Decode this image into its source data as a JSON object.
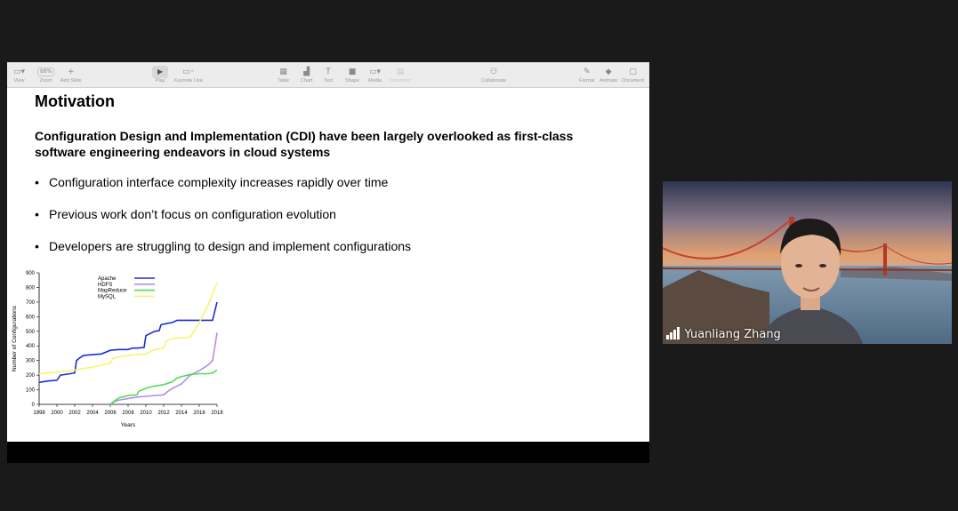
{
  "toolbar": {
    "view": "View",
    "zoom_value": "88%",
    "zoom": "Zoom",
    "add_slide": "Add Slide",
    "play": "Play",
    "keynote_live": "Keynote Live",
    "table": "Table",
    "chart": "Chart",
    "text": "Text",
    "shape": "Shape",
    "media": "Media",
    "comment": "Comment",
    "collaborate": "Collaborate",
    "format": "Format",
    "animate": "Animate",
    "document": "Document"
  },
  "slide": {
    "title": "Motivation",
    "lead": "Configuration Design and Implementation (CDI) have been largely overlooked as first-class software engineering endeavors in cloud systems",
    "bullets": [
      "Configuration interface complexity increases rapidly over time",
      "Previous work don’t focus on configuration evolution",
      "Developers are struggling to design and implement configurations"
    ]
  },
  "participant": {
    "name": "Yuanliang Zhang"
  },
  "chart_data": {
    "type": "line",
    "xlabel": "Years",
    "ylabel": "Number of Configurations",
    "xlim": [
      1998,
      2018
    ],
    "ylim": [
      0,
      900
    ],
    "xticks": [
      "1998",
      "2000",
      "2002",
      "2004",
      "2006",
      "2008",
      "2010",
      "2012",
      "2014",
      "2016",
      "2018"
    ],
    "yticks": [
      "0",
      "100",
      "200",
      "300",
      "400",
      "500",
      "600",
      "700",
      "800",
      "900"
    ],
    "legend_position": "top-left",
    "series": [
      {
        "name": "Apache",
        "color": "#1a2fd6",
        "points": [
          [
            1998,
            150
          ],
          [
            1999,
            160
          ],
          [
            2000,
            165
          ],
          [
            2000.4,
            200
          ],
          [
            2001.5,
            210
          ],
          [
            2002,
            215
          ],
          [
            2002.2,
            300
          ],
          [
            2002.6,
            320
          ],
          [
            2003,
            335
          ],
          [
            2004,
            340
          ],
          [
            2005,
            345
          ],
          [
            2006,
            370
          ],
          [
            2007,
            375
          ],
          [
            2008,
            375
          ],
          [
            2008.5,
            385
          ],
          [
            2009,
            385
          ],
          [
            2009.8,
            390
          ],
          [
            2010,
            470
          ],
          [
            2011,
            500
          ],
          [
            2011.5,
            505
          ],
          [
            2011.7,
            545
          ],
          [
            2012.5,
            555
          ],
          [
            2013,
            560
          ],
          [
            2013.5,
            575
          ],
          [
            2015,
            575
          ],
          [
            2017.5,
            575
          ],
          [
            2017.6,
            600
          ],
          [
            2018,
            700
          ]
        ]
      },
      {
        "name": "HDFS",
        "color": "#b48ee8",
        "points": [
          [
            2006,
            0
          ],
          [
            2006.5,
            20
          ],
          [
            2007,
            30
          ],
          [
            2008,
            40
          ],
          [
            2009,
            50
          ],
          [
            2010,
            55
          ],
          [
            2011,
            60
          ],
          [
            2012,
            65
          ],
          [
            2012.5,
            90
          ],
          [
            2013,
            110
          ],
          [
            2014,
            140
          ],
          [
            2015,
            200
          ],
          [
            2016,
            230
          ],
          [
            2017,
            270
          ],
          [
            2017.5,
            300
          ],
          [
            2018,
            490
          ]
        ]
      },
      {
        "name": "MapReduce",
        "color": "#52dc52",
        "points": [
          [
            2006,
            0
          ],
          [
            2006.5,
            25
          ],
          [
            2007,
            45
          ],
          [
            2008,
            60
          ],
          [
            2009,
            65
          ],
          [
            2009.2,
            90
          ],
          [
            2010,
            110
          ],
          [
            2011,
            125
          ],
          [
            2012,
            135
          ],
          [
            2013,
            155
          ],
          [
            2013.5,
            180
          ],
          [
            2014,
            190
          ],
          [
            2015,
            205
          ],
          [
            2016,
            210
          ],
          [
            2017,
            210
          ],
          [
            2017.5,
            215
          ],
          [
            2018,
            235
          ]
        ]
      },
      {
        "name": "MySQL",
        "color": "#f5f571",
        "points": [
          [
            1998,
            210
          ],
          [
            1999,
            215
          ],
          [
            2000,
            220
          ],
          [
            2001,
            225
          ],
          [
            2002,
            235
          ],
          [
            2003,
            245
          ],
          [
            2004,
            255
          ],
          [
            2005,
            270
          ],
          [
            2006,
            280
          ],
          [
            2006.3,
            315
          ],
          [
            2007,
            325
          ],
          [
            2008,
            335
          ],
          [
            2009,
            340
          ],
          [
            2010,
            345
          ],
          [
            2011,
            375
          ],
          [
            2012,
            385
          ],
          [
            2012.3,
            435
          ],
          [
            2013,
            450
          ],
          [
            2014,
            455
          ],
          [
            2015,
            460
          ],
          [
            2016,
            560
          ],
          [
            2017,
            680
          ],
          [
            2018,
            830
          ]
        ]
      }
    ]
  }
}
